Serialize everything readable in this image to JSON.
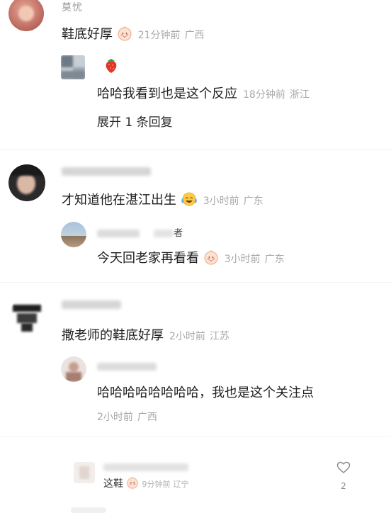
{
  "comments": [
    {
      "name": "莫忧",
      "text": "鞋底好厚",
      "time": "21分钟前",
      "location": "广西",
      "emoji": "baby-face-emoji",
      "replies": [
        {
          "name": "",
          "text": "哈哈我看到也是这个反应",
          "time": "18分钟前",
          "location": "浙江",
          "avatar_sticker": "strawberry-icon"
        }
      ],
      "expand_label": "展开 1 条回复"
    },
    {
      "name": "",
      "text": "才知道他在湛江出生",
      "time": "3小时前",
      "location": "广东",
      "emoji": "crying-laugh-emoji",
      "replies": [
        {
          "name": "者",
          "text": "今天回老家再看看",
          "time": "3小时前",
          "location": "广东",
          "emoji": "baby-face-emoji"
        }
      ]
    },
    {
      "name": "",
      "text": "撒老师的鞋底好厚",
      "time": "2小时前",
      "location": "江苏",
      "replies": [
        {
          "name": "",
          "text": "哈哈哈哈哈哈哈哈，我也是这个关注点",
          "time": "2小时前",
          "location": "广西"
        }
      ]
    },
    {
      "name": "",
      "text": "这鞋",
      "time": "9分钟前",
      "location": "辽宁",
      "emoji": "baby-face-emoji",
      "likes": "2",
      "like_icon": "heart-outline-icon"
    }
  ]
}
